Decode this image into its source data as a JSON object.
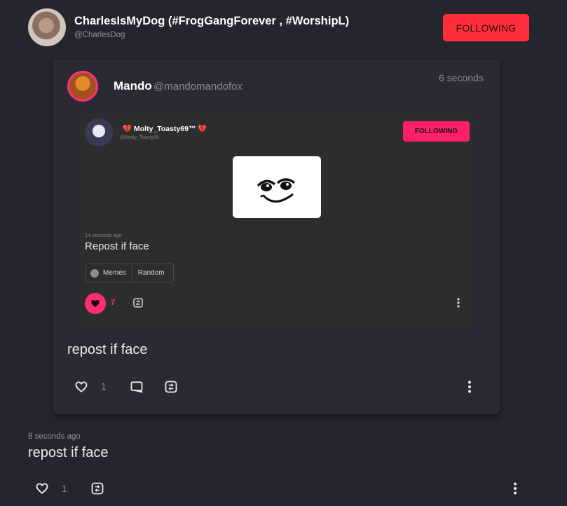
{
  "post": {
    "author_name": "CharlesIsMyDog (#FrogGangForever , #WorshipL)",
    "author_handle": "@CharlesDog",
    "follow_label": "FOLLOWING",
    "time": "8 seconds ago",
    "text": "repost if face",
    "like_count": "1"
  },
  "repost": {
    "author_name": "Mando",
    "author_handle": "@mandomandofox",
    "time": "6 seconds",
    "text": "repost if face",
    "like_count": "1"
  },
  "screenshot": {
    "author_name": "💔 Molty_Toasty69™ 💔",
    "author_handle": "@Molty_Toasty69",
    "follow_label": "FOLLOWING",
    "time": "14 seconds ago",
    "text": "Repost if face",
    "tags": [
      "Memes",
      "Random"
    ],
    "like_count": "7"
  },
  "colors": {
    "background": "#25252d",
    "card": "#2a2a33",
    "following_button": "#ff2e3a",
    "accent_pink": "#ff2d72"
  },
  "icons": [
    "heart-icon",
    "comment-icon",
    "repost-icon",
    "more-vertical-icon",
    "heart-filled-icon"
  ]
}
